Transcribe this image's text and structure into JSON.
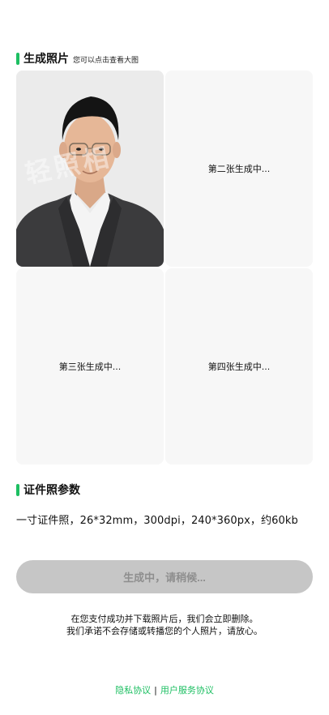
{
  "generate_section": {
    "title": "生成照片",
    "subtitle": "您可以点击查看大图"
  },
  "photos": [
    {
      "status": "",
      "watermark": "轻照相"
    },
    {
      "status": "第二张生成中..."
    },
    {
      "status": "第三张生成中..."
    },
    {
      "status": "第四张生成中..."
    }
  ],
  "params_section": {
    "title": "证件照参数",
    "text": "一寸证件照，26*32mm，300dpi，240*360px，约60kb"
  },
  "generate_button": {
    "label": "生成中，请稍候..."
  },
  "notice": {
    "line1": "在您支付成功并下载照片后，我们会立即删除。",
    "line2": "我们承诺不会存储或转播您的个人照片，请放心。"
  },
  "footer": {
    "privacy_link": "隐私协议",
    "separator": "|",
    "service_link": "用户服务协议"
  },
  "colors": {
    "accent": "#1dbf62",
    "button_disabled_bg": "#c6c6c6",
    "button_disabled_text": "#8e8e8e",
    "placeholder_bg": "#f7f7f7"
  }
}
